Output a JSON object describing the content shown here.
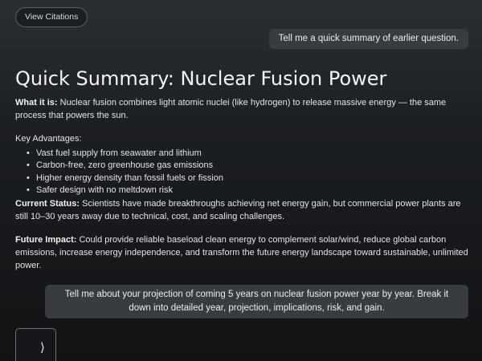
{
  "toolbar": {
    "citations_label": "View Citations"
  },
  "messages": {
    "first_user": "Tell me a quick summary of earlier question.",
    "second_user": "Tell me about your projection of coming 5 years on nuclear fusion power year by year. Break it down into detailed year, projection, implications, risk, and gain."
  },
  "answer": {
    "title": "Quick Summary: Nuclear Fusion Power",
    "what_label": "What it is:",
    "what_text": " Nuclear fusion combines light atomic nuclei (like hydrogen) to release massive energy — the same process that powers the sun.",
    "key_label": "Key Advantages:",
    "advantages": [
      "Vast fuel supply from seawater and lithium",
      "Carbon-free, zero greenhouse gas emissions",
      "Higher energy density than fossil fuels or fission",
      "Safer design with no meltdown risk"
    ],
    "status_label": "Current Status:",
    "status_text": " Scientists have made breakthroughs achieving net energy gain, but commercial power plants are still 10–30 years away due to technical, cost, and scaling challenges.",
    "future_label": "Future Impact:",
    "future_text": " Could provide reliable baseload clean energy to complement solar/wind, reduce global carbon emissions, increase energy independence, and transform the future energy landscape toward sustainable, unlimited power."
  },
  "composer": {
    "icon": "chevron-right-icon",
    "glyph": "⟩"
  }
}
